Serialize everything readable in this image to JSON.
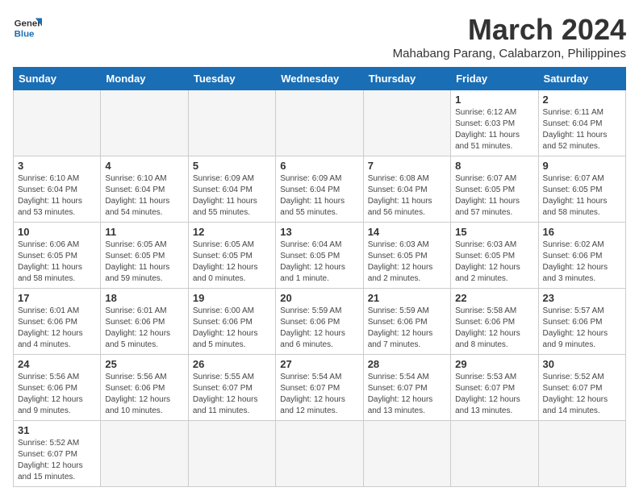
{
  "header": {
    "logo_general": "General",
    "logo_blue": "Blue",
    "title": "March 2024",
    "subtitle": "Mahabang Parang, Calabarzon, Philippines"
  },
  "columns": [
    "Sunday",
    "Monday",
    "Tuesday",
    "Wednesday",
    "Thursday",
    "Friday",
    "Saturday"
  ],
  "weeks": [
    [
      {
        "day": "",
        "info": "",
        "empty": true
      },
      {
        "day": "",
        "info": "",
        "empty": true
      },
      {
        "day": "",
        "info": "",
        "empty": true
      },
      {
        "day": "",
        "info": "",
        "empty": true
      },
      {
        "day": "",
        "info": "",
        "empty": true
      },
      {
        "day": "1",
        "info": "Sunrise: 6:12 AM\nSunset: 6:03 PM\nDaylight: 11 hours and 51 minutes.",
        "empty": false
      },
      {
        "day": "2",
        "info": "Sunrise: 6:11 AM\nSunset: 6:04 PM\nDaylight: 11 hours and 52 minutes.",
        "empty": false
      }
    ],
    [
      {
        "day": "3",
        "info": "Sunrise: 6:10 AM\nSunset: 6:04 PM\nDaylight: 11 hours and 53 minutes.",
        "empty": false
      },
      {
        "day": "4",
        "info": "Sunrise: 6:10 AM\nSunset: 6:04 PM\nDaylight: 11 hours and 54 minutes.",
        "empty": false
      },
      {
        "day": "5",
        "info": "Sunrise: 6:09 AM\nSunset: 6:04 PM\nDaylight: 11 hours and 55 minutes.",
        "empty": false
      },
      {
        "day": "6",
        "info": "Sunrise: 6:09 AM\nSunset: 6:04 PM\nDaylight: 11 hours and 55 minutes.",
        "empty": false
      },
      {
        "day": "7",
        "info": "Sunrise: 6:08 AM\nSunset: 6:04 PM\nDaylight: 11 hours and 56 minutes.",
        "empty": false
      },
      {
        "day": "8",
        "info": "Sunrise: 6:07 AM\nSunset: 6:05 PM\nDaylight: 11 hours and 57 minutes.",
        "empty": false
      },
      {
        "day": "9",
        "info": "Sunrise: 6:07 AM\nSunset: 6:05 PM\nDaylight: 11 hours and 58 minutes.",
        "empty": false
      }
    ],
    [
      {
        "day": "10",
        "info": "Sunrise: 6:06 AM\nSunset: 6:05 PM\nDaylight: 11 hours and 58 minutes.",
        "empty": false
      },
      {
        "day": "11",
        "info": "Sunrise: 6:05 AM\nSunset: 6:05 PM\nDaylight: 11 hours and 59 minutes.",
        "empty": false
      },
      {
        "day": "12",
        "info": "Sunrise: 6:05 AM\nSunset: 6:05 PM\nDaylight: 12 hours and 0 minutes.",
        "empty": false
      },
      {
        "day": "13",
        "info": "Sunrise: 6:04 AM\nSunset: 6:05 PM\nDaylight: 12 hours and 1 minute.",
        "empty": false
      },
      {
        "day": "14",
        "info": "Sunrise: 6:03 AM\nSunset: 6:05 PM\nDaylight: 12 hours and 2 minutes.",
        "empty": false
      },
      {
        "day": "15",
        "info": "Sunrise: 6:03 AM\nSunset: 6:05 PM\nDaylight: 12 hours and 2 minutes.",
        "empty": false
      },
      {
        "day": "16",
        "info": "Sunrise: 6:02 AM\nSunset: 6:06 PM\nDaylight: 12 hours and 3 minutes.",
        "empty": false
      }
    ],
    [
      {
        "day": "17",
        "info": "Sunrise: 6:01 AM\nSunset: 6:06 PM\nDaylight: 12 hours and 4 minutes.",
        "empty": false
      },
      {
        "day": "18",
        "info": "Sunrise: 6:01 AM\nSunset: 6:06 PM\nDaylight: 12 hours and 5 minutes.",
        "empty": false
      },
      {
        "day": "19",
        "info": "Sunrise: 6:00 AM\nSunset: 6:06 PM\nDaylight: 12 hours and 5 minutes.",
        "empty": false
      },
      {
        "day": "20",
        "info": "Sunrise: 5:59 AM\nSunset: 6:06 PM\nDaylight: 12 hours and 6 minutes.",
        "empty": false
      },
      {
        "day": "21",
        "info": "Sunrise: 5:59 AM\nSunset: 6:06 PM\nDaylight: 12 hours and 7 minutes.",
        "empty": false
      },
      {
        "day": "22",
        "info": "Sunrise: 5:58 AM\nSunset: 6:06 PM\nDaylight: 12 hours and 8 minutes.",
        "empty": false
      },
      {
        "day": "23",
        "info": "Sunrise: 5:57 AM\nSunset: 6:06 PM\nDaylight: 12 hours and 9 minutes.",
        "empty": false
      }
    ],
    [
      {
        "day": "24",
        "info": "Sunrise: 5:56 AM\nSunset: 6:06 PM\nDaylight: 12 hours and 9 minutes.",
        "empty": false
      },
      {
        "day": "25",
        "info": "Sunrise: 5:56 AM\nSunset: 6:06 PM\nDaylight: 12 hours and 10 minutes.",
        "empty": false
      },
      {
        "day": "26",
        "info": "Sunrise: 5:55 AM\nSunset: 6:07 PM\nDaylight: 12 hours and 11 minutes.",
        "empty": false
      },
      {
        "day": "27",
        "info": "Sunrise: 5:54 AM\nSunset: 6:07 PM\nDaylight: 12 hours and 12 minutes.",
        "empty": false
      },
      {
        "day": "28",
        "info": "Sunrise: 5:54 AM\nSunset: 6:07 PM\nDaylight: 12 hours and 13 minutes.",
        "empty": false
      },
      {
        "day": "29",
        "info": "Sunrise: 5:53 AM\nSunset: 6:07 PM\nDaylight: 12 hours and 13 minutes.",
        "empty": false
      },
      {
        "day": "30",
        "info": "Sunrise: 5:52 AM\nSunset: 6:07 PM\nDaylight: 12 hours and 14 minutes.",
        "empty": false
      }
    ],
    [
      {
        "day": "31",
        "info": "Sunrise: 5:52 AM\nSunset: 6:07 PM\nDaylight: 12 hours and 15 minutes.",
        "empty": false
      },
      {
        "day": "",
        "info": "",
        "empty": true
      },
      {
        "day": "",
        "info": "",
        "empty": true
      },
      {
        "day": "",
        "info": "",
        "empty": true
      },
      {
        "day": "",
        "info": "",
        "empty": true
      },
      {
        "day": "",
        "info": "",
        "empty": true
      },
      {
        "day": "",
        "info": "",
        "empty": true
      }
    ]
  ]
}
